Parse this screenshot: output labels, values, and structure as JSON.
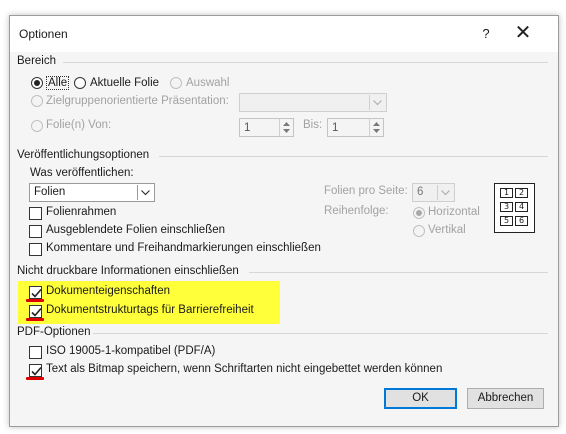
{
  "dialog": {
    "title": "Optionen",
    "help_label": "?",
    "close_label": "✕"
  },
  "bereich": {
    "heading": "Bereich",
    "alle_label": "Alle",
    "aktuelle_folie_label": "Aktuelle Folie",
    "auswahl_label": "Auswahl",
    "zielgruppe_label": "Zielgruppenorientierte Präsentation:",
    "zielgruppe_value": "",
    "folien_label": "Folie(n)  Von:",
    "von_value": "1",
    "bis_label": "Bis:",
    "bis_value": "1"
  },
  "veroeffentlichung": {
    "heading": "Veröffentlichungsoptionen",
    "was_label": "Was veröffentlichen:",
    "was_value": "Folien",
    "folienrahmen_label": "Folienrahmen",
    "ausgeblendete_label": "Ausgeblendete Folien einschließen",
    "kommentare_label": "Kommentare und Freihandmarkierungen einschließen",
    "folien_pro_seite_label": "Folien pro Seite:",
    "folien_pro_seite_value": "6",
    "reihenfolge_label": "Reihenfolge:",
    "horizontal_label": "Horizontal",
    "vertikal_label": "Vertikal",
    "preview_numbers": [
      "1",
      "2",
      "3",
      "4",
      "5",
      "6"
    ]
  },
  "nicht_druckbar": {
    "heading": "Nicht druckbare Informationen einschließen",
    "dokumenteigenschaften_label": "Dokumenteigenschaften",
    "dokumentstrukturtags_label": "Dokumentstrukturtags für Barrierefreiheit"
  },
  "pdf": {
    "heading": "PDF-Optionen",
    "iso_label": "ISO 19005-1-kompatibel (PDF/A)",
    "bitmap_label": "Text als Bitmap speichern, wenn Schriftarten nicht eingebettet werden können"
  },
  "buttons": {
    "ok_label": "OK",
    "cancel_label": "Abbrechen"
  },
  "colors": {
    "highlight": "#ffff3a",
    "annotation_red": "#e00000",
    "default_button_border": "#0078d7"
  }
}
